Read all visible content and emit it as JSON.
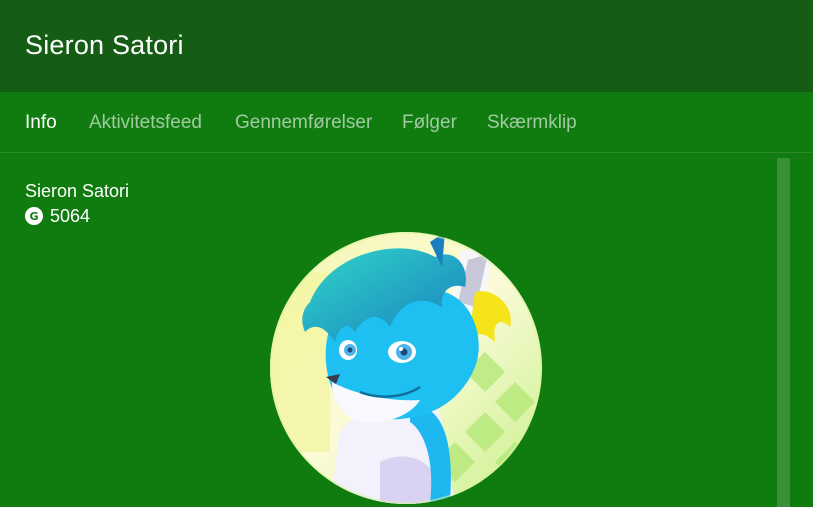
{
  "header": {
    "title": "Sieron Satori"
  },
  "tabs": [
    {
      "label": "Info"
    },
    {
      "label": "Aktivitetsfeed"
    },
    {
      "label": "Gennemførelser"
    },
    {
      "label": "Følger"
    },
    {
      "label": "Skærmklip"
    }
  ],
  "profile": {
    "name": "Sieron Satori",
    "gamerscore_icon": "G",
    "gamerscore": "5064"
  },
  "colors": {
    "background": "#107c10",
    "titlebar": "#155d14",
    "tab_active": "#ffffff",
    "tab_inactive": "#9fcb9f"
  }
}
